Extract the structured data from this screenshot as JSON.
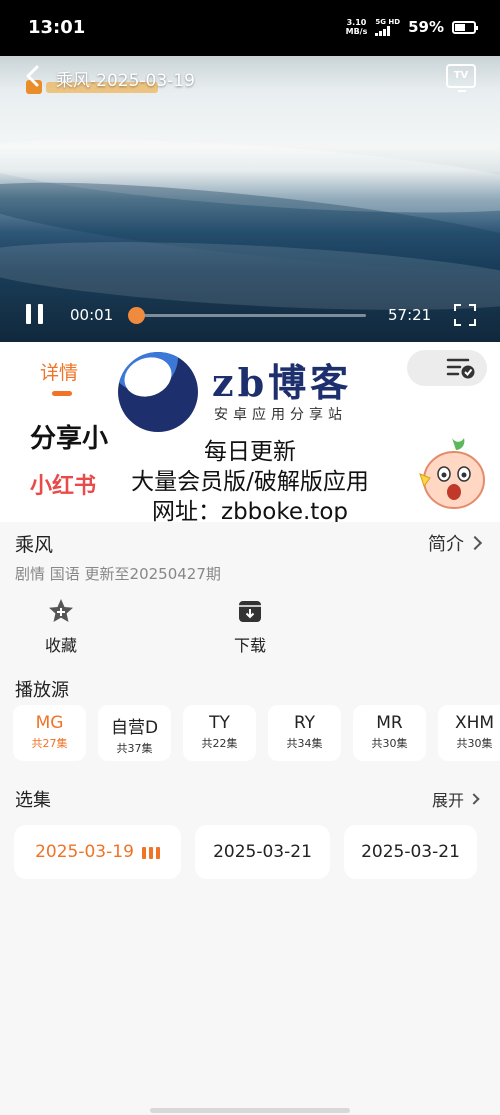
{
  "status_bar": {
    "time": "13:01",
    "net_speed_value": "3.10",
    "net_speed_unit": "MB/s",
    "network_type": "5G HD",
    "battery_percent": "59%",
    "battery_level": 0.59
  },
  "player": {
    "title": "乘风-2025-03-19",
    "cast_icon_label": "TV",
    "current_time": "00:01",
    "total_time": "57:21",
    "progress": 0.0003
  },
  "tabs": {
    "detail_label": "详情"
  },
  "banner": {
    "line1": "分享小",
    "line2": "小红书"
  },
  "watermark": {
    "title": "zb博客",
    "subtitle": "安卓应用分享站",
    "line1": "每日更新",
    "line2": "大量会员版/破解版应用",
    "line3": "网址：zbboke.top"
  },
  "info": {
    "show_title": "乘风",
    "intro_label": "简介",
    "meta": "剧情 国语 更新至20250427期",
    "favorite_label": "收藏",
    "download_label": "下载"
  },
  "sources": {
    "title": "播放源",
    "items": [
      {
        "name": "MG",
        "count": "共27集",
        "active": true
      },
      {
        "name": "自营D",
        "count": "共37集",
        "active": false
      },
      {
        "name": "TY",
        "count": "共22集",
        "active": false
      },
      {
        "name": "RY",
        "count": "共34集",
        "active": false
      },
      {
        "name": "MR",
        "count": "共30集",
        "active": false
      },
      {
        "name": "XHM",
        "count": "共30集",
        "active": false
      }
    ]
  },
  "episodes": {
    "title": "选集",
    "expand_label": "展开",
    "items": [
      {
        "label": "2025-03-19",
        "active": true
      },
      {
        "label": "2025-03-21",
        "active": false
      },
      {
        "label": "2025-03-21",
        "active": false
      }
    ]
  },
  "colors": {
    "accent": "#f07326",
    "watermark_navy": "#1e2f6e",
    "banner_red": "#e94b4b"
  }
}
